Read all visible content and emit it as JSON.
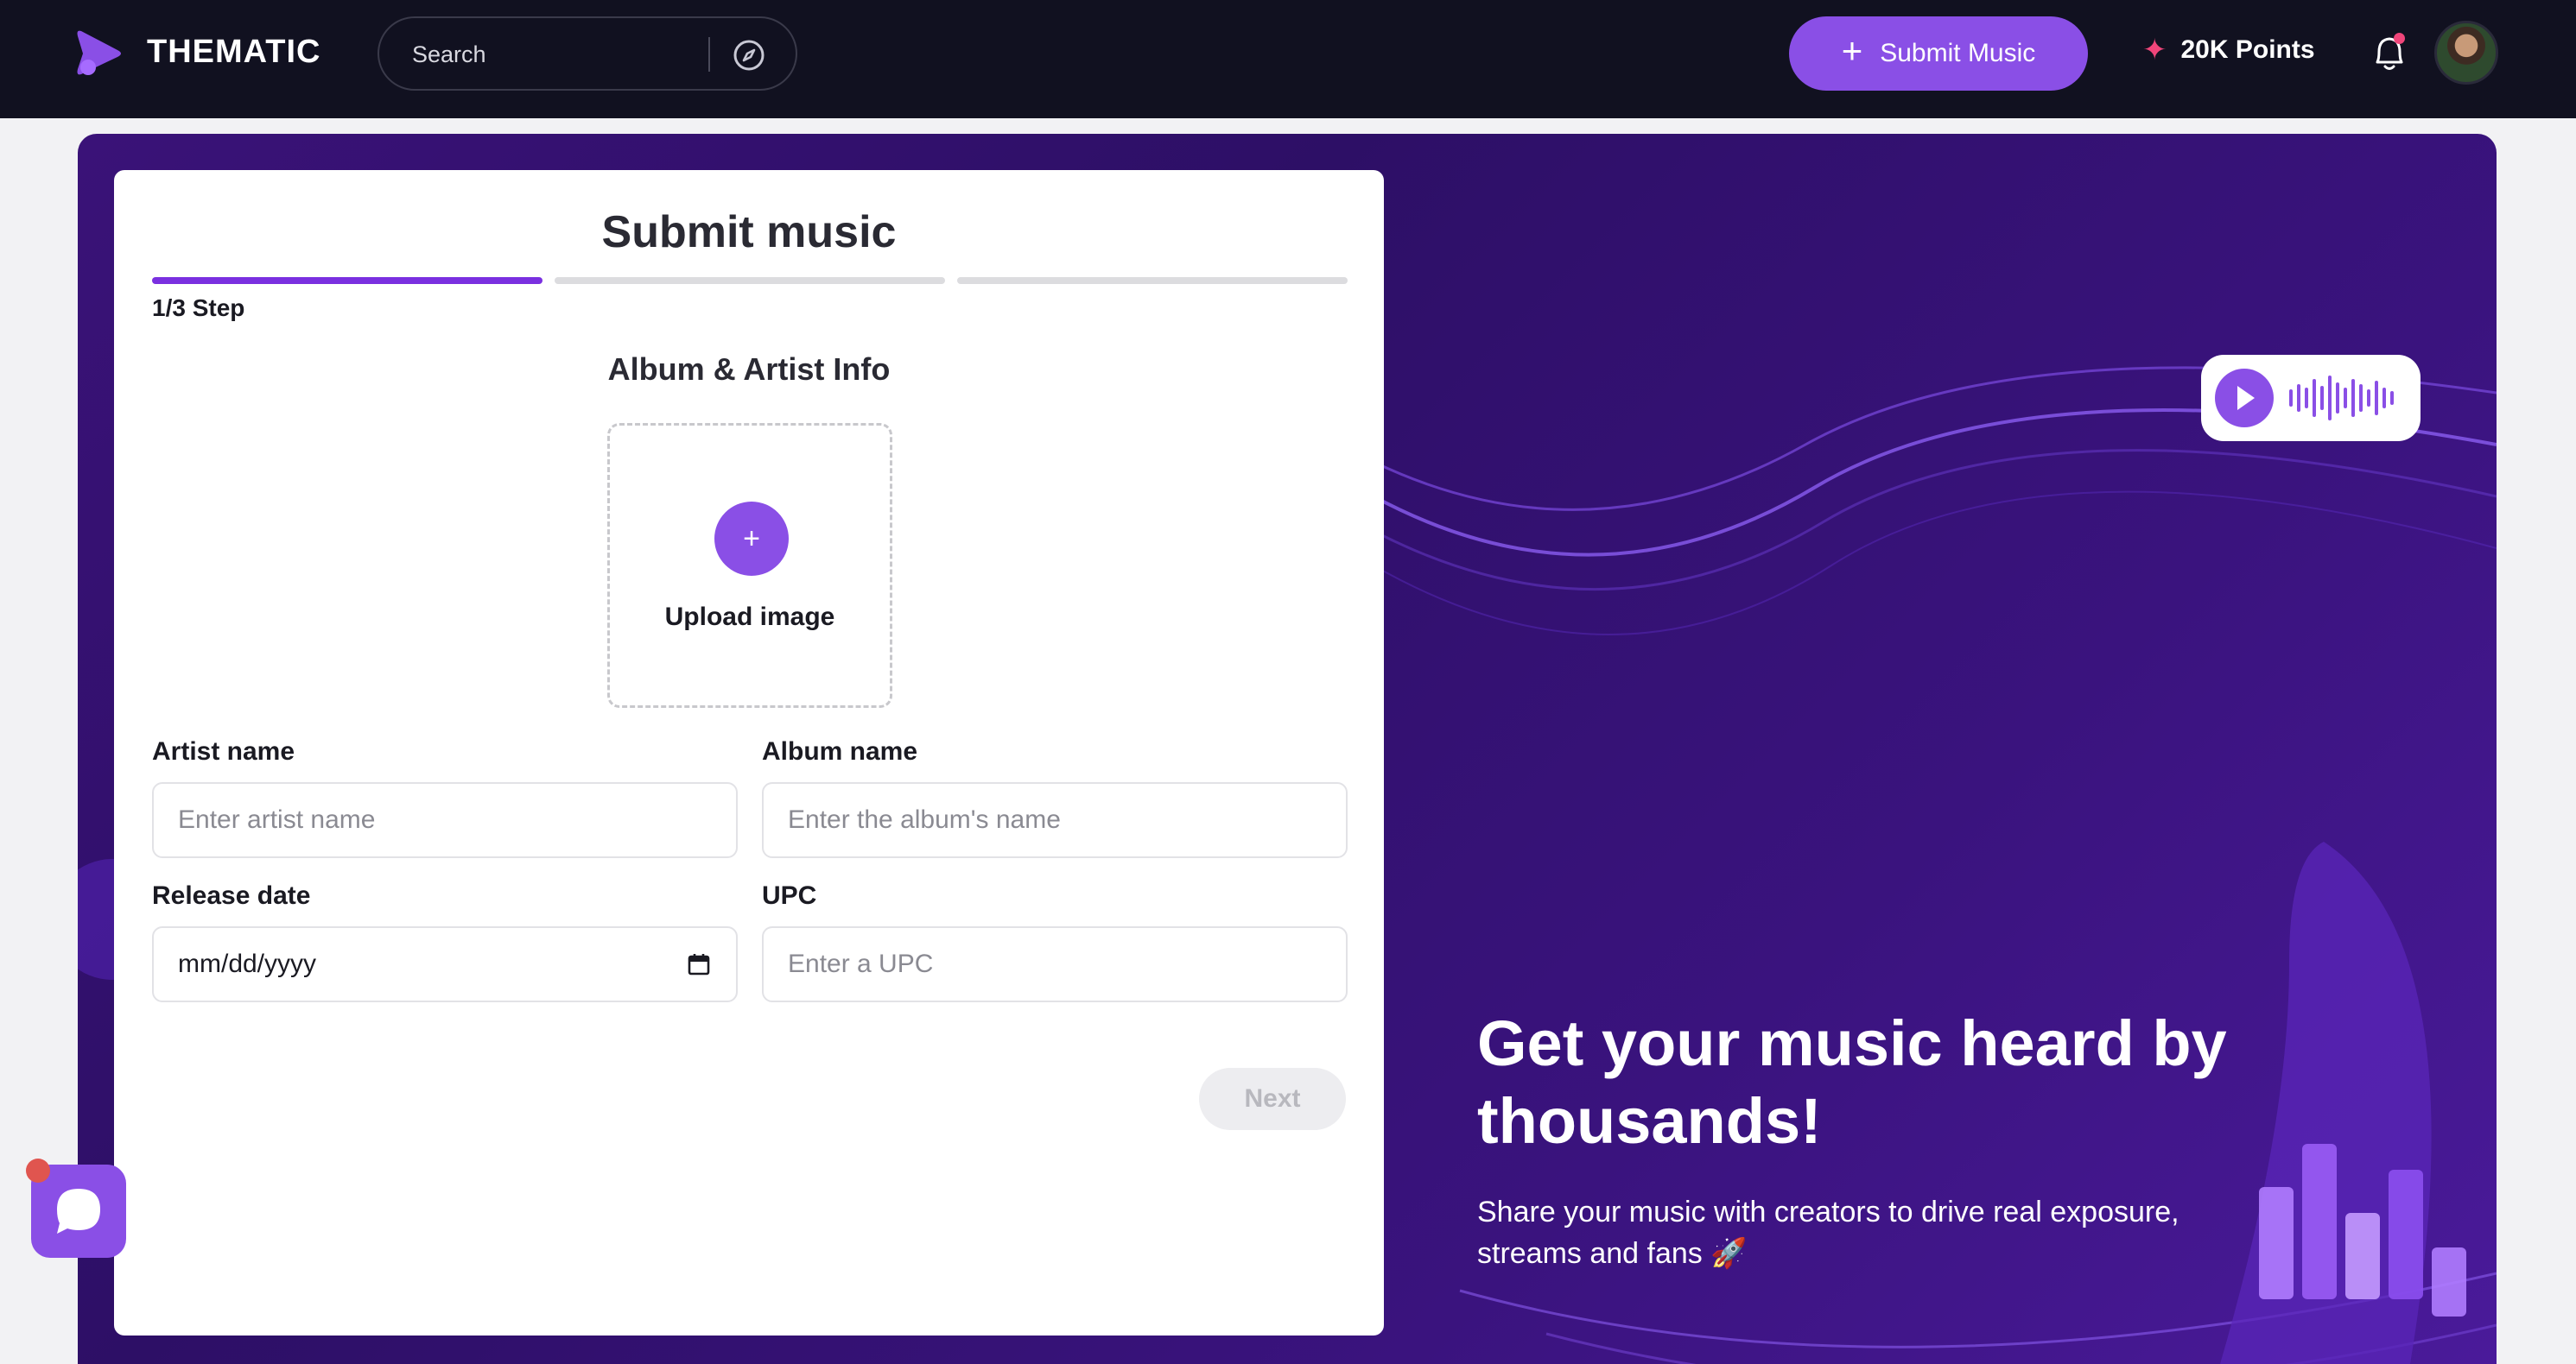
{
  "header": {
    "logo_text": "THEMATIC",
    "search_placeholder": "Search",
    "submit_label": "Submit Music",
    "points_label": "20K Points"
  },
  "hero": {
    "title": "Get your music heard by thousands!",
    "subtitle": "Share your music with creators to drive real exposure, streams and fans 🚀"
  },
  "form": {
    "title": "Submit music",
    "step_label": "1/3 Step",
    "progress_steps": 3,
    "current_step": 1,
    "section_title": "Album & Artist Info",
    "upload_label": "Upload image",
    "upload_plus": "+",
    "artist_label": "Artist name",
    "artist_placeholder": "Enter artist name",
    "album_label": "Album name",
    "album_placeholder": "Enter the album's name",
    "release_label": "Release date",
    "release_value": "mm/dd/yyyy",
    "upc_label": "UPC",
    "upc_placeholder": "Enter a UPC",
    "next_label": "Next"
  },
  "colors": {
    "accent": "#8a4fe6",
    "progress_active": "#7a30e0",
    "topbar_bg": "#111120",
    "hero_bg": "#2d0f66",
    "notification_dot": "#f0457a"
  }
}
